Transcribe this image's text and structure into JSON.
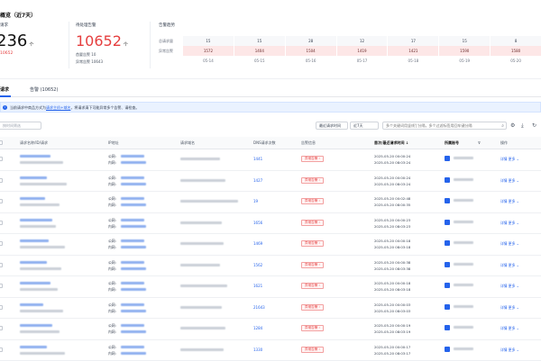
{
  "summary": {
    "title": "概览（近7天）",
    "card1": {
      "label": "请求",
      "value": "236",
      "unit": "个",
      "sub": "10652"
    },
    "card2": {
      "label": "待处理告警",
      "value": "10652",
      "unit": "个",
      "sub1": "首要告警 10",
      "sub2": "异常告警 10643"
    },
    "trend": {
      "label": "告警趋势",
      "rows": [
        {
          "label": "总请求量",
          "cells": [
            "15",
            "15",
            "28",
            "12",
            "17",
            "15",
            "8"
          ]
        },
        {
          "label": "异常告警",
          "cells": [
            "1572",
            "1404",
            "1504",
            "1419",
            "1421",
            "1590",
            "1580"
          ]
        },
        {
          "label": "",
          "cells": [
            "05-14",
            "05-15",
            "05-16",
            "05-17",
            "05-18",
            "05-19",
            "05-20"
          ]
        }
      ]
    }
  },
  "tabs": [
    {
      "label": "请求"
    },
    {
      "label": "告警 (10652)"
    }
  ],
  "banner": {
    "prefix": "当前请求中商品方式为",
    "link": "请求主机+域名",
    "suffix": "，将请求清下可能异常多个告警、请检查。"
  },
  "toolbar": {
    "select_placeholder": "按时间筛选",
    "filter1": "最近请求时间",
    "filter2": "近7天",
    "search_placeholder": "多个关键词用竖线'|'分隔，多个过滤标签用回车键分隔",
    "search_icon": "search-icon",
    "icons": [
      "gear-icon",
      "download-icon",
      "settings-icon"
    ]
  },
  "table": {
    "headers": {
      "name": "请求名称/ID/请求",
      "ip": "IP地址",
      "domain": "请求域名",
      "dns": "DNS请求次数",
      "status": "告警信息",
      "time": "首次/最近请求时间",
      "provider": "所属账号",
      "ops": "操作"
    },
    "ip_public": "公网:",
    "ip_private": "内网:",
    "op_label": "详情  更多",
    "rows": [
      {
        "count": "1441",
        "tag": "异常告警",
        "t1": "2025-05-20 00:00:24",
        "t2": "2025-05-20 08:03:24"
      },
      {
        "count": "1427",
        "tag": "异常告警",
        "t1": "2025-05-20 00:00:24",
        "t2": "2025-05-20 08:03:24"
      },
      {
        "count": "19",
        "tag": "异常告警",
        "t1": "2025-05-20 00:02:48",
        "t2": "2025-05-20 08:00:35"
      },
      {
        "count": "1656",
        "tag": "异常告警",
        "t1": "2025-05-20 00:00:23",
        "t2": "2025-05-20 08:03:23"
      },
      {
        "count": "1469",
        "tag": "异常告警",
        "t1": "2025-05-20 00:00:18",
        "t2": "2025-05-20 08:03:18"
      },
      {
        "count": "1562",
        "tag": "异常告警",
        "t1": "2025-05-20 00:00:38",
        "t2": "2025-05-20 08:03:38"
      },
      {
        "count": "1621",
        "tag": "异常告警",
        "t1": "2025-05-20 00:00:18",
        "t2": "2025-05-20 08:03:18"
      },
      {
        "count": "21643",
        "tag": "异常告警",
        "t1": "2025-05-20 00:00:03",
        "t2": "2025-05-20 08:03:03"
      },
      {
        "count": "1284",
        "tag": "异常告警",
        "t1": "2025-05-20 00:00:19",
        "t2": "2025-05-20 08:03:19"
      },
      {
        "count": "1330",
        "tag": "异常告警",
        "t1": "2025-05-20 00:00:17",
        "t2": "2025-05-20 08:03:17"
      }
    ]
  }
}
